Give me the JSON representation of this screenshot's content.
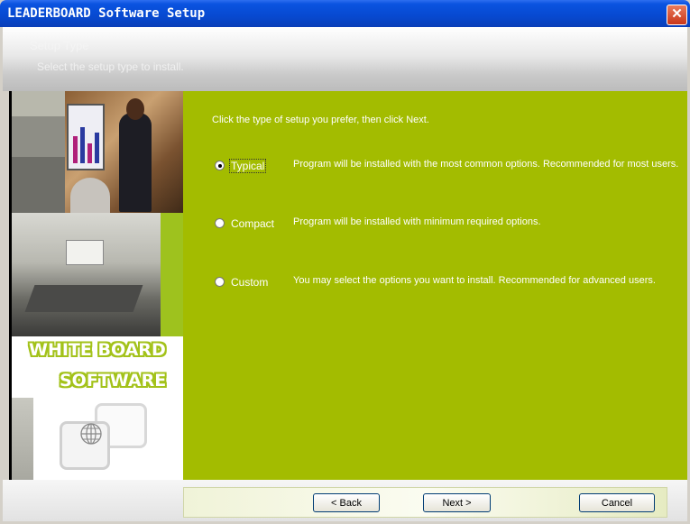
{
  "window": {
    "title": "LEADERBOARD Software Setup",
    "close_symbol": "✕"
  },
  "header": {
    "title": "Setup Type",
    "subtitle": "Select the setup type to install."
  },
  "banner": {
    "line1": "WHITE BOARD",
    "line2": "SOFTWARE"
  },
  "main": {
    "instruction": "Click the type of setup you prefer, then click Next.",
    "options": [
      {
        "label": "Typical",
        "description": "Program will be installed with the most common options.  Recommended for most users.",
        "selected": true
      },
      {
        "label": "Compact",
        "description": "Program will be installed with minimum required options.",
        "selected": false
      },
      {
        "label": "Custom",
        "description": "You may select the options you want to install. Recommended for advanced users.",
        "selected": false
      }
    ]
  },
  "buttons": {
    "back": "< Back",
    "next": "Next >",
    "cancel": "Cancel"
  },
  "colors": {
    "content_bg": "#a3bc00",
    "titlebar": "#0a53e0",
    "close": "#c9361a"
  }
}
